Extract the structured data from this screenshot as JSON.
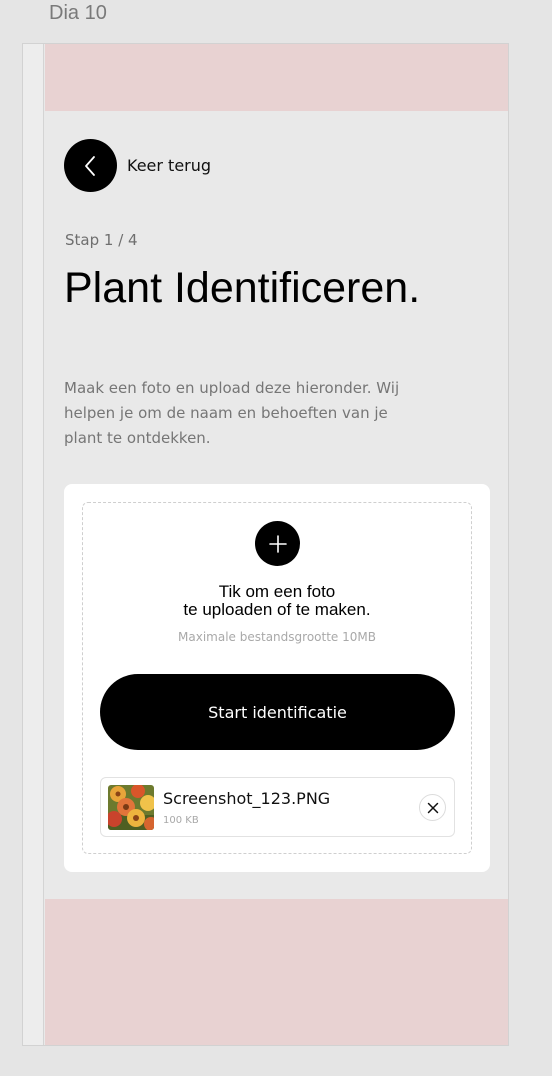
{
  "frame": {
    "label": "Dia 10"
  },
  "header": {
    "back_label": "Keer terug",
    "back_icon": "chevron-left-icon"
  },
  "main": {
    "step": "Stap 1 / 4",
    "title": "Plant Identificeren.",
    "description": "Maak een foto en upload deze hieronder. Wij helpen je om de naam en behoeften van je plant te ontdekken."
  },
  "upload": {
    "add_icon": "plus-icon",
    "text_line1": "Tik om een foto",
    "text_line2": "te uploaden of te maken.",
    "max_size": "Maximale bestandsgrootte 10MB",
    "start_button": "Start identificatie"
  },
  "file": {
    "name": "Screenshot_123.PNG",
    "size": "100 KB",
    "remove_icon": "close-icon",
    "thumbnail": "flower-photo"
  },
  "colors": {
    "accent": "#000000",
    "band": "#e8d2d2",
    "background": "#e9e9e9",
    "card": "#ffffff"
  }
}
